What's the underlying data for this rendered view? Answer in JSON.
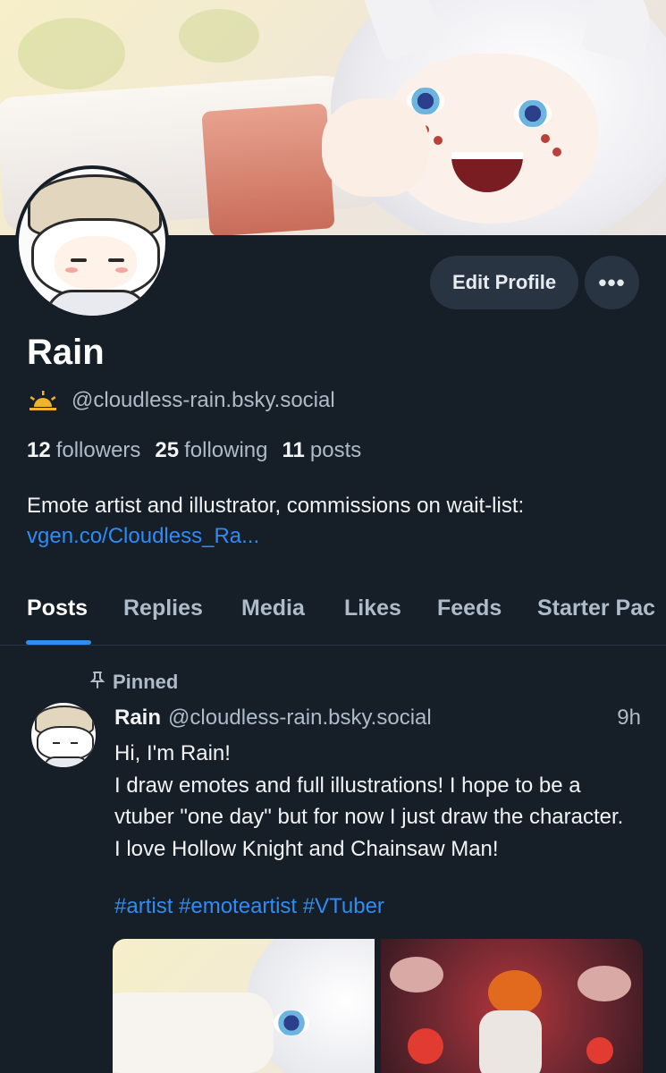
{
  "profile": {
    "name": "Rain",
    "handle": "@cloudless-rain.bsky.social",
    "edit_label": "Edit Profile",
    "more_label": "•••",
    "stats": {
      "followers_count": "12",
      "followers_label": "followers",
      "following_count": "25",
      "following_label": "following",
      "posts_count": "11",
      "posts_label": "posts"
    },
    "bio": "Emote artist and illustrator, commissions on wait-list:",
    "bio_link": "vgen.co/Cloudless_Ra...",
    "accent_color": "#2f8cf5",
    "badge_icon": "sunrise-icon"
  },
  "tabs": [
    {
      "label": "Posts",
      "active": true
    },
    {
      "label": "Replies",
      "active": false
    },
    {
      "label": "Media",
      "active": false
    },
    {
      "label": "Likes",
      "active": false
    },
    {
      "label": "Feeds",
      "active": false
    },
    {
      "label": "Starter Pac",
      "active": false
    }
  ],
  "post": {
    "pinned_label": "Pinned",
    "author": "Rain",
    "handle": "@cloudless-rain.bsky.social",
    "time": "9h",
    "text_line1": "Hi, I'm Rain!",
    "text_body": "I draw emotes and full illustrations! I hope to be a vtuber \"one day\" but for now I just draw the character. I love Hollow Knight and Chainsaw Man!",
    "tags": "#artist #emoteartist #VTuber"
  }
}
